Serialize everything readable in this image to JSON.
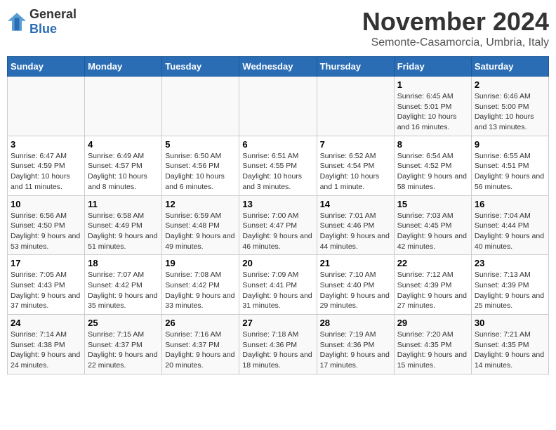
{
  "logo": {
    "general": "General",
    "blue": "Blue"
  },
  "title": "November 2024",
  "subtitle": "Semonte-Casamorcia, Umbria, Italy",
  "days_of_week": [
    "Sunday",
    "Monday",
    "Tuesday",
    "Wednesday",
    "Thursday",
    "Friday",
    "Saturday"
  ],
  "weeks": [
    [
      {
        "day": "",
        "sunrise": "",
        "sunset": "",
        "daylight": ""
      },
      {
        "day": "",
        "sunrise": "",
        "sunset": "",
        "daylight": ""
      },
      {
        "day": "",
        "sunrise": "",
        "sunset": "",
        "daylight": ""
      },
      {
        "day": "",
        "sunrise": "",
        "sunset": "",
        "daylight": ""
      },
      {
        "day": "",
        "sunrise": "",
        "sunset": "",
        "daylight": ""
      },
      {
        "day": "1",
        "sunrise": "Sunrise: 6:45 AM",
        "sunset": "Sunset: 5:01 PM",
        "daylight": "Daylight: 10 hours and 16 minutes."
      },
      {
        "day": "2",
        "sunrise": "Sunrise: 6:46 AM",
        "sunset": "Sunset: 5:00 PM",
        "daylight": "Daylight: 10 hours and 13 minutes."
      }
    ],
    [
      {
        "day": "3",
        "sunrise": "Sunrise: 6:47 AM",
        "sunset": "Sunset: 4:59 PM",
        "daylight": "Daylight: 10 hours and 11 minutes."
      },
      {
        "day": "4",
        "sunrise": "Sunrise: 6:49 AM",
        "sunset": "Sunset: 4:57 PM",
        "daylight": "Daylight: 10 hours and 8 minutes."
      },
      {
        "day": "5",
        "sunrise": "Sunrise: 6:50 AM",
        "sunset": "Sunset: 4:56 PM",
        "daylight": "Daylight: 10 hours and 6 minutes."
      },
      {
        "day": "6",
        "sunrise": "Sunrise: 6:51 AM",
        "sunset": "Sunset: 4:55 PM",
        "daylight": "Daylight: 10 hours and 3 minutes."
      },
      {
        "day": "7",
        "sunrise": "Sunrise: 6:52 AM",
        "sunset": "Sunset: 4:54 PM",
        "daylight": "Daylight: 10 hours and 1 minute."
      },
      {
        "day": "8",
        "sunrise": "Sunrise: 6:54 AM",
        "sunset": "Sunset: 4:52 PM",
        "daylight": "Daylight: 9 hours and 58 minutes."
      },
      {
        "day": "9",
        "sunrise": "Sunrise: 6:55 AM",
        "sunset": "Sunset: 4:51 PM",
        "daylight": "Daylight: 9 hours and 56 minutes."
      }
    ],
    [
      {
        "day": "10",
        "sunrise": "Sunrise: 6:56 AM",
        "sunset": "Sunset: 4:50 PM",
        "daylight": "Daylight: 9 hours and 53 minutes."
      },
      {
        "day": "11",
        "sunrise": "Sunrise: 6:58 AM",
        "sunset": "Sunset: 4:49 PM",
        "daylight": "Daylight: 9 hours and 51 minutes."
      },
      {
        "day": "12",
        "sunrise": "Sunrise: 6:59 AM",
        "sunset": "Sunset: 4:48 PM",
        "daylight": "Daylight: 9 hours and 49 minutes."
      },
      {
        "day": "13",
        "sunrise": "Sunrise: 7:00 AM",
        "sunset": "Sunset: 4:47 PM",
        "daylight": "Daylight: 9 hours and 46 minutes."
      },
      {
        "day": "14",
        "sunrise": "Sunrise: 7:01 AM",
        "sunset": "Sunset: 4:46 PM",
        "daylight": "Daylight: 9 hours and 44 minutes."
      },
      {
        "day": "15",
        "sunrise": "Sunrise: 7:03 AM",
        "sunset": "Sunset: 4:45 PM",
        "daylight": "Daylight: 9 hours and 42 minutes."
      },
      {
        "day": "16",
        "sunrise": "Sunrise: 7:04 AM",
        "sunset": "Sunset: 4:44 PM",
        "daylight": "Daylight: 9 hours and 40 minutes."
      }
    ],
    [
      {
        "day": "17",
        "sunrise": "Sunrise: 7:05 AM",
        "sunset": "Sunset: 4:43 PM",
        "daylight": "Daylight: 9 hours and 37 minutes."
      },
      {
        "day": "18",
        "sunrise": "Sunrise: 7:07 AM",
        "sunset": "Sunset: 4:42 PM",
        "daylight": "Daylight: 9 hours and 35 minutes."
      },
      {
        "day": "19",
        "sunrise": "Sunrise: 7:08 AM",
        "sunset": "Sunset: 4:42 PM",
        "daylight": "Daylight: 9 hours and 33 minutes."
      },
      {
        "day": "20",
        "sunrise": "Sunrise: 7:09 AM",
        "sunset": "Sunset: 4:41 PM",
        "daylight": "Daylight: 9 hours and 31 minutes."
      },
      {
        "day": "21",
        "sunrise": "Sunrise: 7:10 AM",
        "sunset": "Sunset: 4:40 PM",
        "daylight": "Daylight: 9 hours and 29 minutes."
      },
      {
        "day": "22",
        "sunrise": "Sunrise: 7:12 AM",
        "sunset": "Sunset: 4:39 PM",
        "daylight": "Daylight: 9 hours and 27 minutes."
      },
      {
        "day": "23",
        "sunrise": "Sunrise: 7:13 AM",
        "sunset": "Sunset: 4:39 PM",
        "daylight": "Daylight: 9 hours and 25 minutes."
      }
    ],
    [
      {
        "day": "24",
        "sunrise": "Sunrise: 7:14 AM",
        "sunset": "Sunset: 4:38 PM",
        "daylight": "Daylight: 9 hours and 24 minutes."
      },
      {
        "day": "25",
        "sunrise": "Sunrise: 7:15 AM",
        "sunset": "Sunset: 4:37 PM",
        "daylight": "Daylight: 9 hours and 22 minutes."
      },
      {
        "day": "26",
        "sunrise": "Sunrise: 7:16 AM",
        "sunset": "Sunset: 4:37 PM",
        "daylight": "Daylight: 9 hours and 20 minutes."
      },
      {
        "day": "27",
        "sunrise": "Sunrise: 7:18 AM",
        "sunset": "Sunset: 4:36 PM",
        "daylight": "Daylight: 9 hours and 18 minutes."
      },
      {
        "day": "28",
        "sunrise": "Sunrise: 7:19 AM",
        "sunset": "Sunset: 4:36 PM",
        "daylight": "Daylight: 9 hours and 17 minutes."
      },
      {
        "day": "29",
        "sunrise": "Sunrise: 7:20 AM",
        "sunset": "Sunset: 4:35 PM",
        "daylight": "Daylight: 9 hours and 15 minutes."
      },
      {
        "day": "30",
        "sunrise": "Sunrise: 7:21 AM",
        "sunset": "Sunset: 4:35 PM",
        "daylight": "Daylight: 9 hours and 14 minutes."
      }
    ]
  ]
}
